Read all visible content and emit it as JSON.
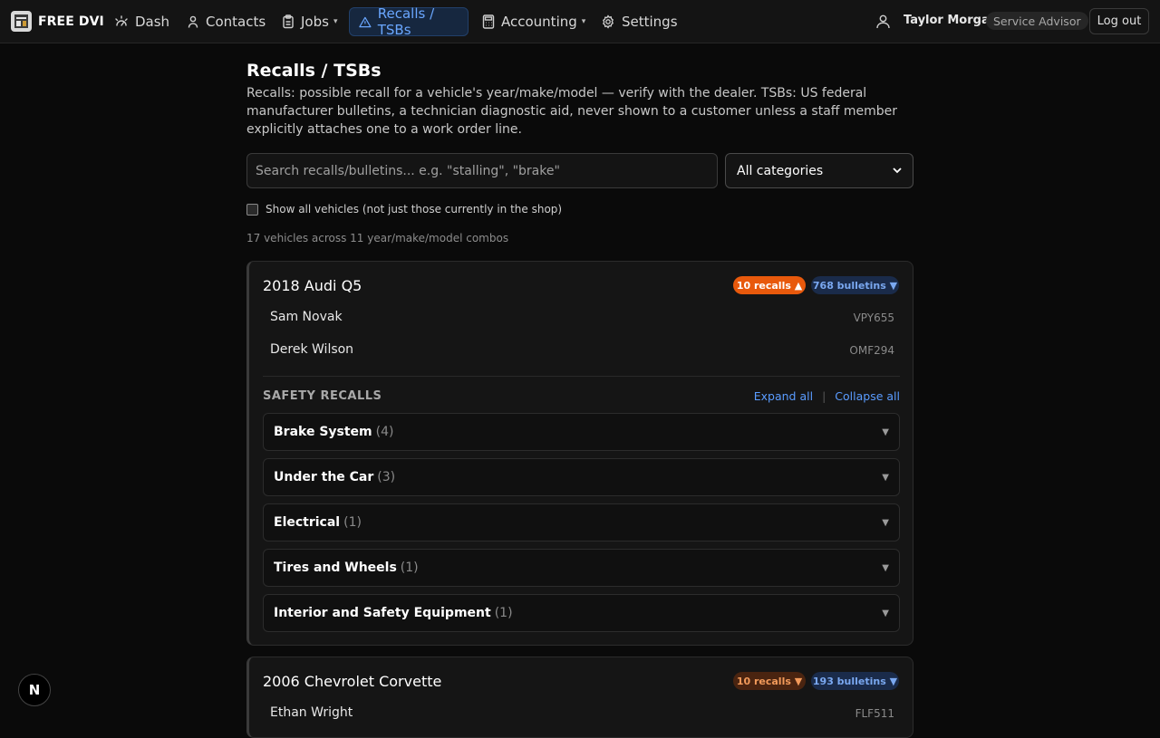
{
  "app": {
    "logo_text": "FREE DVI"
  },
  "nav": {
    "items": [
      {
        "label": "Dash",
        "icon": "dashboard-icon"
      },
      {
        "label": "Contacts",
        "icon": "contacts-icon"
      },
      {
        "label": "Jobs",
        "icon": "clipboard-icon",
        "caret": "▾"
      },
      {
        "label": "Recalls / TSBs",
        "icon": "warning-icon",
        "active": true
      },
      {
        "label": "Accounting",
        "icon": "calculator-icon",
        "caret": "▾"
      },
      {
        "label": "Settings",
        "icon": "gear-icon"
      }
    ],
    "user_name": "Taylor Morgan",
    "user_role": "Service Advisor",
    "logout_label": "Log out"
  },
  "page": {
    "title": "Recalls / TSBs",
    "description": "Recalls: possible recall for a vehicle's year/make/model — verify with the dealer. TSBs: US federal manufacturer bulletins, a technician diagnostic aid, never shown to a customer unless a staff member explicitly attaches one to a work order line.",
    "search_placeholder": "Search recalls/bulletins... e.g. \"stalling\", \"brake\"",
    "category_selected": "All categories",
    "show_all_label": "Show all vehicles (not just those currently in the shop)",
    "show_all_checked": false,
    "count_text": "17 vehicles across 11 year/make/model combos"
  },
  "vehicles": [
    {
      "title": "2018 Audi Q5",
      "recalls_label": "10 recalls ▲",
      "bulletins_label": "768 bulletins ▼",
      "owners": [
        {
          "name": "Sam Novak",
          "plate": "VPY655"
        },
        {
          "name": "Derek Wilson",
          "plate": "OMF294"
        }
      ],
      "section_title": "SAFETY RECALLS",
      "expand_all": "Expand all",
      "separator": "|",
      "collapse_all": "Collapse all",
      "categories": [
        {
          "label": "Brake System",
          "count": "(4)"
        },
        {
          "label": "Under the Car",
          "count": "(3)"
        },
        {
          "label": "Electrical",
          "count": "(1)"
        },
        {
          "label": "Tires and Wheels",
          "count": "(1)"
        },
        {
          "label": "Interior and Safety Equipment",
          "count": "(1)"
        }
      ]
    },
    {
      "title": "2006 Chevrolet Corvette",
      "recalls_label": "10 recalls ▼",
      "bulletins_label": "193 bulletins ▼",
      "owners": [
        {
          "name": "Ethan Wright",
          "plate": "FLF511"
        }
      ]
    }
  ],
  "colors": {
    "accent": "#6aa7ff",
    "recall_active": "#e8590c",
    "bulletin": "#7aa8f0"
  },
  "dev_badge": "N"
}
